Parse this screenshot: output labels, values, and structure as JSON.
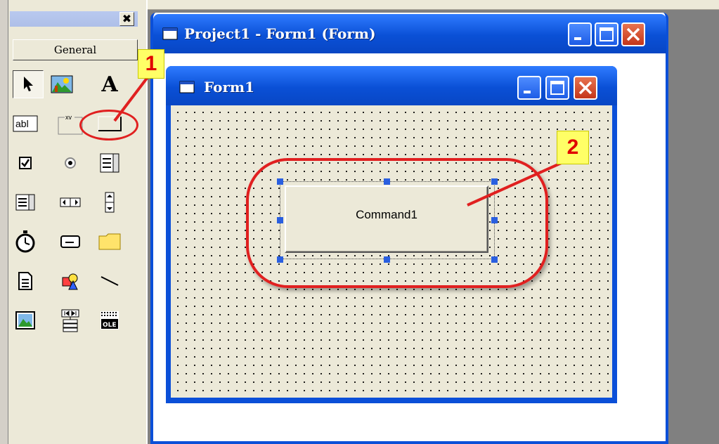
{
  "toolbox": {
    "tab_label": "General",
    "close_glyph": "✖",
    "tools": [
      {
        "name": "pointer",
        "icon": "pointer-icon"
      },
      {
        "name": "picture-box",
        "icon": "picture-box-icon"
      },
      {
        "name": "label",
        "icon": "label-icon",
        "glyph": "A"
      },
      {
        "name": "text-box",
        "icon": "textbox-icon",
        "glyph": "abl"
      },
      {
        "name": "frame",
        "icon": "frame-icon",
        "glyph": "xv"
      },
      {
        "name": "command-button",
        "icon": "command-button-icon"
      },
      {
        "name": "check-box",
        "icon": "checkbox-icon"
      },
      {
        "name": "option-button",
        "icon": "option-button-icon"
      },
      {
        "name": "combo-box",
        "icon": "combobox-icon"
      },
      {
        "name": "list-box",
        "icon": "listbox-icon"
      },
      {
        "name": "hscroll",
        "icon": "hscroll-icon"
      },
      {
        "name": "vscroll",
        "icon": "vscroll-icon"
      },
      {
        "name": "timer",
        "icon": "timer-icon"
      },
      {
        "name": "drive-list",
        "icon": "drive-list-icon"
      },
      {
        "name": "dir-list",
        "icon": "folder-icon"
      },
      {
        "name": "file-list",
        "icon": "file-list-icon"
      },
      {
        "name": "shape",
        "icon": "shape-icon"
      },
      {
        "name": "line",
        "icon": "line-icon"
      },
      {
        "name": "image",
        "icon": "image-icon"
      },
      {
        "name": "data",
        "icon": "data-control-icon"
      },
      {
        "name": "ole",
        "icon": "ole-icon",
        "glyph": "OLE"
      }
    ]
  },
  "project_window": {
    "title": "Project1 - Form1 (Form)"
  },
  "form_window": {
    "title": "Form1"
  },
  "command_button": {
    "caption": "Command1"
  },
  "annotations": {
    "one": "1",
    "two": "2",
    "color": "#e02020"
  }
}
